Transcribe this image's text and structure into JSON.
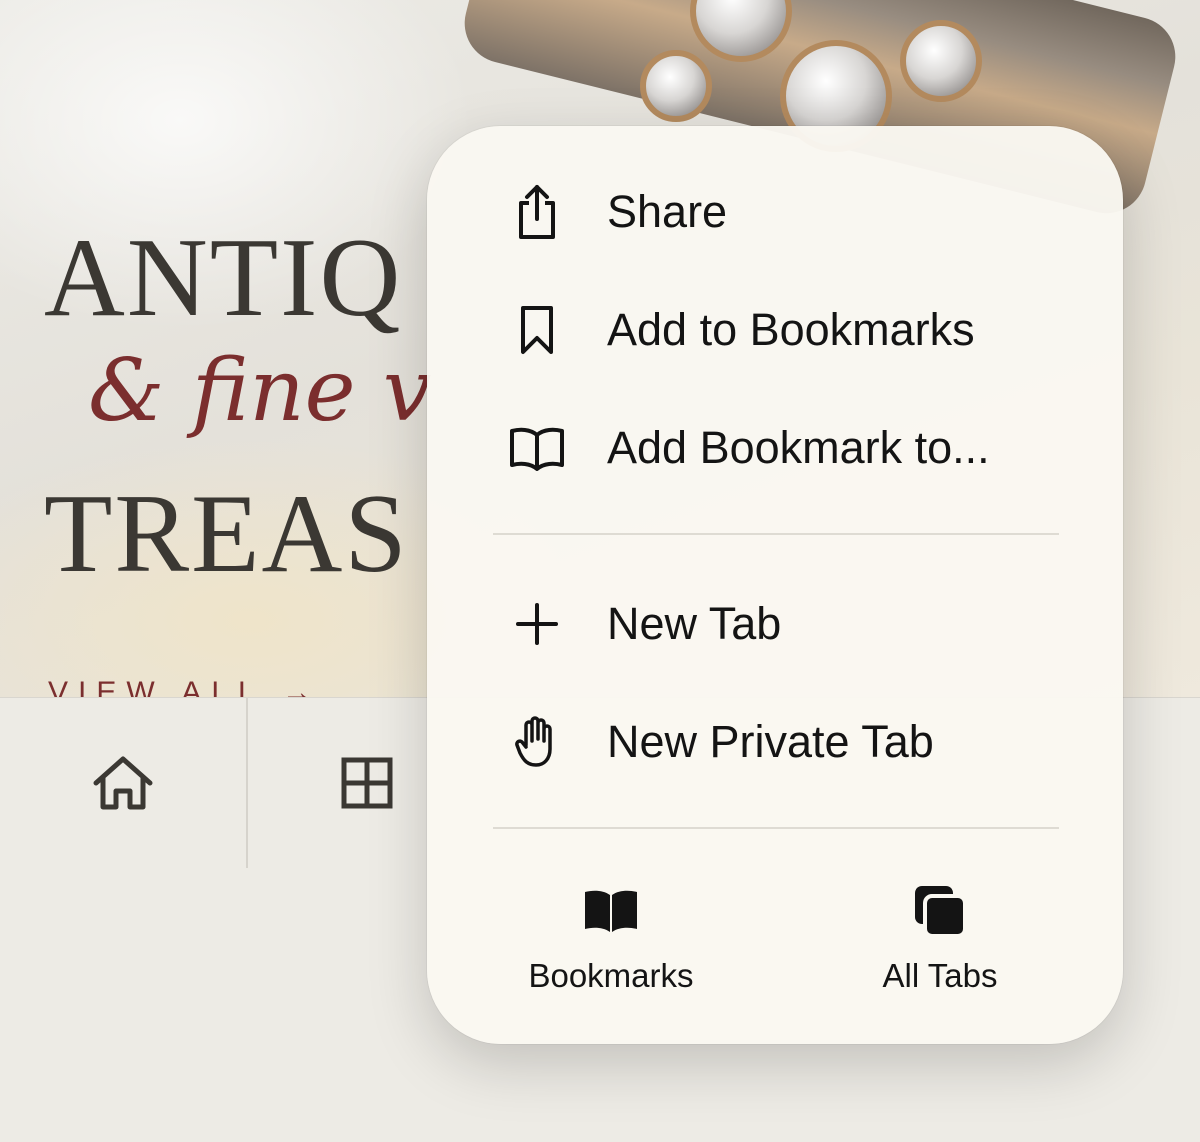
{
  "hero": {
    "title_line1": "ANTIQ",
    "title_line2": "& fine v",
    "title_line3": "TREAS",
    "view_all": "VIEW ALL →"
  },
  "menu": {
    "items": [
      {
        "label": "Share",
        "icon": "share-icon"
      },
      {
        "label": "Add to Bookmarks",
        "icon": "bookmark-icon"
      },
      {
        "label": "Add Bookmark to...",
        "icon": "book-open-icon"
      },
      {
        "label": "New Tab",
        "icon": "plus-icon"
      },
      {
        "label": "New Private Tab",
        "icon": "hand-icon"
      }
    ],
    "bottom": [
      {
        "label": "Bookmarks",
        "icon": "bookmarks-book-icon"
      },
      {
        "label": "All Tabs",
        "icon": "tabs-icon"
      }
    ]
  },
  "colors": {
    "menu_bg": "#faf8f1",
    "text": "#141414",
    "accent_red": "#7b2e2e",
    "serif_dark": "#3b3833"
  }
}
